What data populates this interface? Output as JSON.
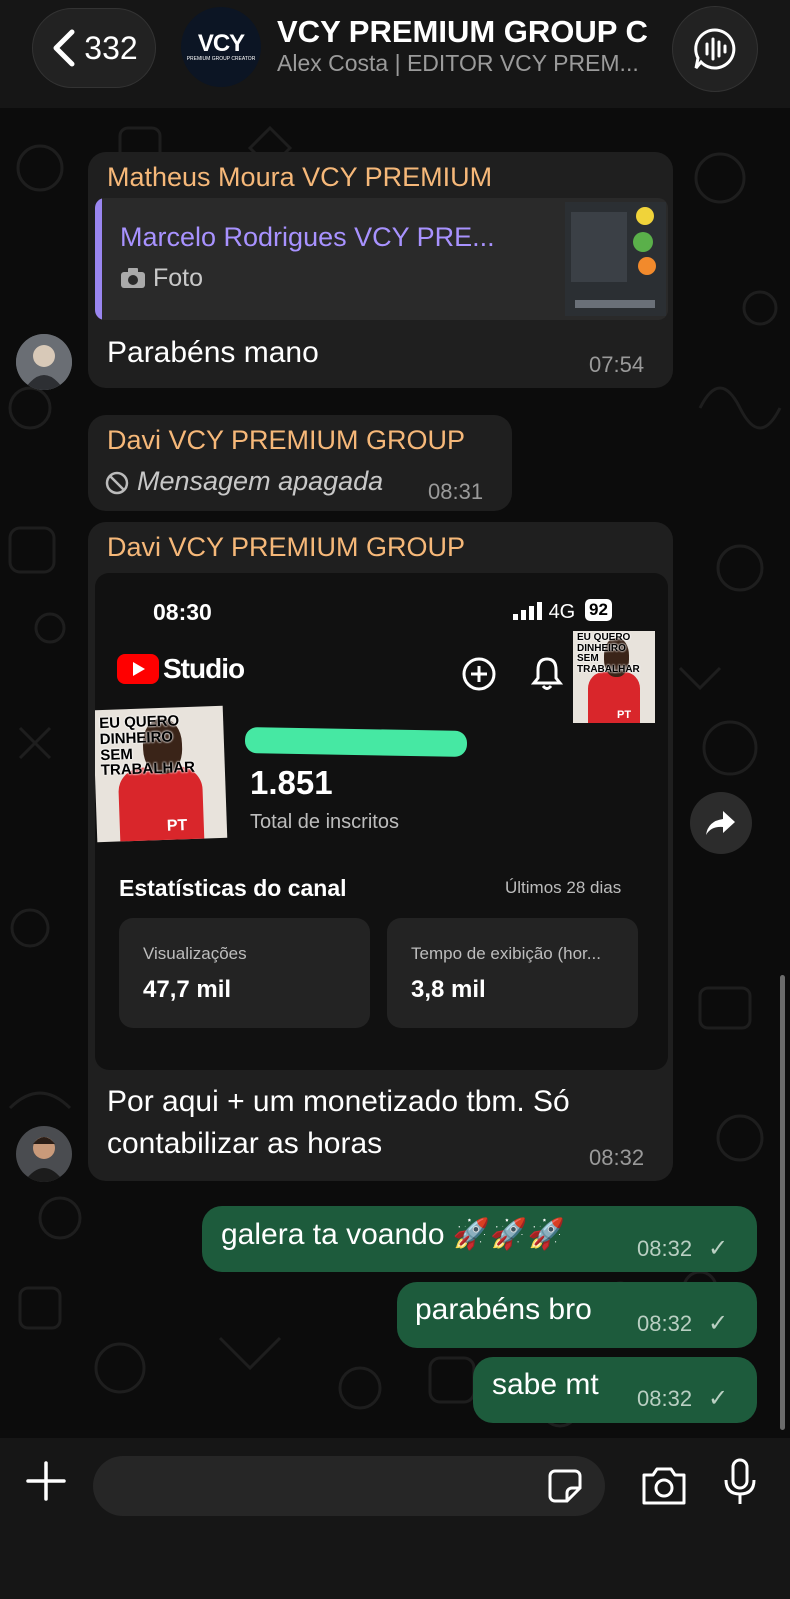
{
  "header": {
    "back_count": "332",
    "group_logo": "VCY",
    "group_logo_sub": "PREMIUM GROUP CREATOR",
    "title": "VCY PREMIUM GROUP C",
    "subtitle": "Alex Costa | EDITOR VCY PREM..."
  },
  "messages": {
    "m1": {
      "sender": "Matheus Moura VCY PREMIUM",
      "reply_name": "Marcelo Rodrigues VCY PRE...",
      "reply_type": "Foto",
      "text": "Parabéns mano",
      "time": "07:54"
    },
    "m2": {
      "sender": "Davi VCY PREMIUM GROUP",
      "text": "Mensagem apagada",
      "time": "08:31"
    },
    "m3": {
      "sender": "Davi VCY PREMIUM GROUP",
      "screenshot": {
        "status_time": "08:30",
        "network": "4G",
        "battery": "92",
        "app_name": "Studio",
        "poster_text": "EU QUERO DINHEIRO SEM TRABALHAR",
        "poster_badge": "PT",
        "subscribers": "1.851",
        "subscribers_label": "Total de inscritos",
        "stats_title": "Estatísticas do canal",
        "stats_range": "Últimos 28 dias",
        "views_label": "Visualizações",
        "views_value": "47,7 mil",
        "watch_label": "Tempo de exibição (hor...",
        "watch_value": "3,8 mil"
      },
      "text_line1": "Por aqui + um monetizado tbm. Só",
      "text_line2": "contabilizar as horas",
      "time": "08:32"
    },
    "out1": {
      "text": "galera ta voando 🚀🚀🚀",
      "time": "08:32"
    },
    "out2": {
      "text": "parabéns bro",
      "time": "08:32"
    },
    "out3": {
      "text": "sabe mt",
      "time": "08:32"
    }
  },
  "icons": {
    "back": "chevron-left-icon",
    "call": "voice-chat-icon",
    "forward": "forward-icon",
    "attach": "plus-icon",
    "sticker": "sticker-icon",
    "camera": "camera-icon",
    "mic": "microphone-icon",
    "deleted": "blocked-icon",
    "photo": "camera-small-icon"
  },
  "colors": {
    "sender": "#f6b879",
    "reply_accent": "#9a86f0",
    "outgoing_bubble": "#1d5b3c",
    "incoming_bubble": "#1f1f1f"
  }
}
